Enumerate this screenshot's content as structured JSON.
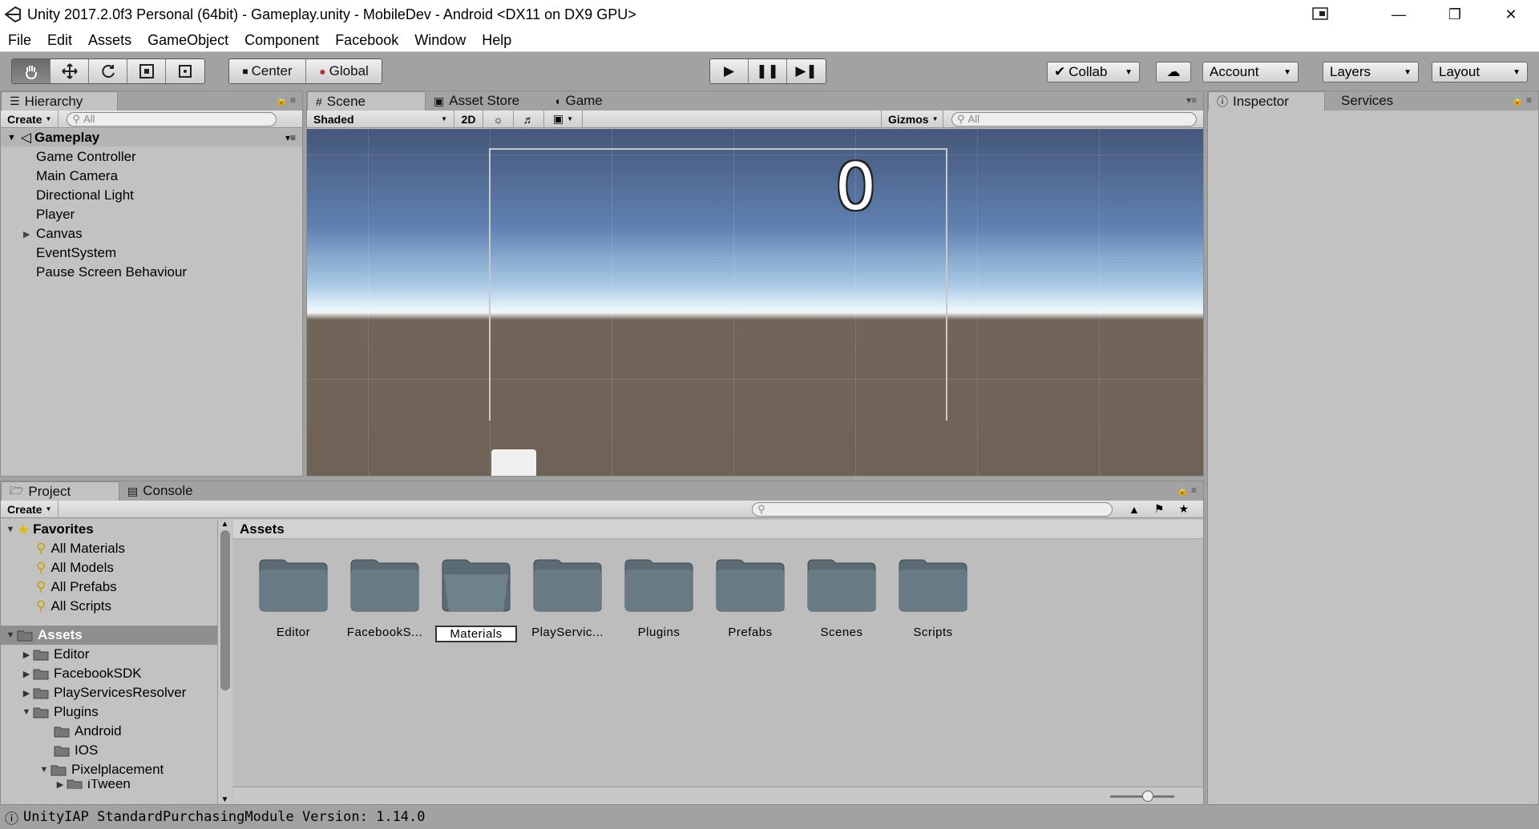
{
  "window": {
    "title": "Unity 2017.2.0f3 Personal (64bit) - Gameplay.unity - MobileDev - Android <DX11 on DX9 GPU>"
  },
  "menu": [
    "File",
    "Edit",
    "Assets",
    "GameObject",
    "Component",
    "Facebook",
    "Window",
    "Help"
  ],
  "toolbar": {
    "pivot_label": "Center",
    "space_label": "Global",
    "collab_label": "Collab",
    "account_label": "Account",
    "layers_label": "Layers",
    "layout_label": "Layout"
  },
  "hierarchy": {
    "tab_label": "Hierarchy",
    "create_label": "Create",
    "search_placeholder": "All",
    "scene_name": "Gameplay",
    "items": [
      "Game Controller",
      "Main Camera",
      "Directional Light",
      "Player",
      "Canvas",
      "EventSystem",
      "Pause Screen Behaviour"
    ]
  },
  "scene": {
    "tabs": [
      "Scene",
      "Asset Store",
      "Game"
    ],
    "shading_mode": "Shaded",
    "mode_2d": "2D",
    "gizmos_label": "Gizmos",
    "search_placeholder": "All",
    "score_text": "0"
  },
  "inspector": {
    "tabs": [
      "Inspector",
      "Services"
    ]
  },
  "project": {
    "tabs": [
      "Project",
      "Console"
    ],
    "create_label": "Create",
    "favorites_label": "Favorites",
    "favorites": [
      "All Materials",
      "All Models",
      "All Prefabs",
      "All Scripts"
    ],
    "assets_root": "Assets",
    "tree": [
      "Editor",
      "FacebookSDK",
      "PlayServicesResolver",
      "Plugins",
      "Android",
      "IOS",
      "Pixelplacement",
      "iTween"
    ],
    "assets_header": "Assets",
    "folders": [
      "Editor",
      "FacebookS...",
      "Materials",
      "PlayServic...",
      "Plugins",
      "Prefabs",
      "Scenes",
      "Scripts"
    ],
    "selected_folder": "Materials"
  },
  "status": {
    "message": "UnityIAP StandardPurchasingModule Version: 1.14.0"
  }
}
